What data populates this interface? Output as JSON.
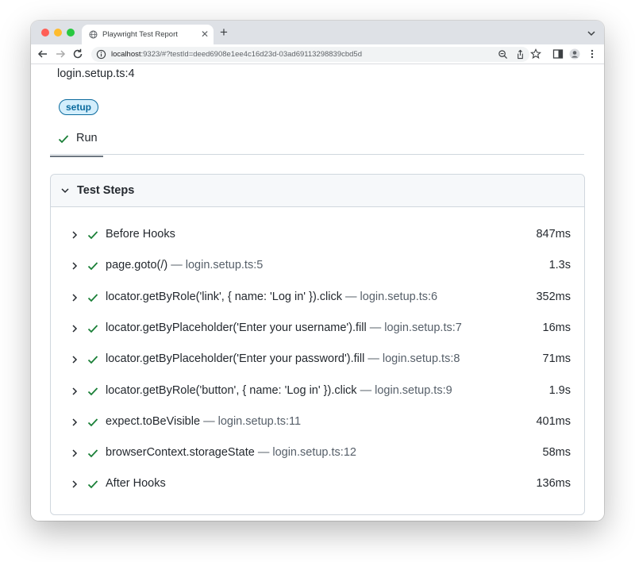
{
  "browser": {
    "tab_title": "Playwright Test Report",
    "new_tab_icon": "plus-icon",
    "url_host": "localhost",
    "url_rest": ":9323/#?testId=deed6908e1ee4c16d23d-03ad69113298839cbd5d",
    "colors": {
      "close": "#ff5f57",
      "minimize": "#febc2e",
      "maximize": "#28c840"
    }
  },
  "test": {
    "location": "login.setup.ts:4",
    "label": "setup",
    "run_tab": "Run"
  },
  "steps_panel": {
    "title": "Test Steps",
    "steps": [
      {
        "title": "Before Hooks",
        "location": "",
        "duration": "847ms"
      },
      {
        "title": "page.goto(/)",
        "location": "— login.setup.ts:5",
        "duration": "1.3s"
      },
      {
        "title": "locator.getByRole('link', { name: 'Log in' }).click",
        "location": "— login.setup.ts:6",
        "duration": "352ms"
      },
      {
        "title": "locator.getByPlaceholder('Enter your username').fill",
        "location": "— login.setup.ts:7",
        "duration": "16ms"
      },
      {
        "title": "locator.getByPlaceholder('Enter your password').fill",
        "location": "— login.setup.ts:8",
        "duration": "71ms"
      },
      {
        "title": "locator.getByRole('button', { name: 'Log in' }).click",
        "location": "— login.setup.ts:9",
        "duration": "1.9s"
      },
      {
        "title": "expect.toBeVisible",
        "location": "— login.setup.ts:11",
        "duration": "401ms"
      },
      {
        "title": "browserContext.storageState",
        "location": "— login.setup.ts:12",
        "duration": "58ms"
      },
      {
        "title": "After Hooks",
        "location": "",
        "duration": "136ms"
      }
    ]
  },
  "colors": {
    "success": "#1a7f37",
    "label_border": "#0b6b9e",
    "label_bg": "#d3eefc"
  }
}
